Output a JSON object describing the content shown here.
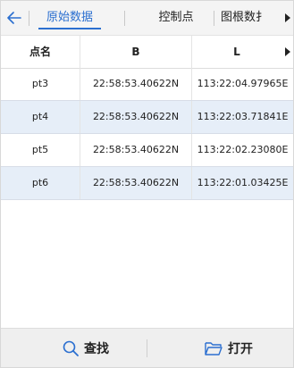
{
  "tabs": [
    {
      "label": "原始数据",
      "active": true
    },
    {
      "label": "控制点",
      "active": false
    },
    {
      "label": "图根数扌",
      "active": false
    }
  ],
  "table": {
    "columns": [
      "点名",
      "B",
      "L"
    ],
    "rows": [
      {
        "name": "pt3",
        "b": "22:58:53.40622N",
        "l": "113:22:04.97965E",
        "selected": false
      },
      {
        "name": "pt4",
        "b": "22:58:53.40622N",
        "l": "113:22:03.71841E",
        "selected": true
      },
      {
        "name": "pt5",
        "b": "22:58:53.40622N",
        "l": "113:22:02.23080E",
        "selected": false
      },
      {
        "name": "pt6",
        "b": "22:58:53.40622N",
        "l": "113:22:01.03425E",
        "selected": true
      }
    ]
  },
  "bottom": {
    "find_label": "查找",
    "open_label": "打开"
  },
  "colors": {
    "accent": "#2b6fd0",
    "selected_row": "#e6eef8",
    "bar_bg": "#f4f4f4"
  },
  "icons": {
    "back": "arrow-left-icon",
    "find": "magnifier-icon",
    "open": "folder-open-icon",
    "more": "triangle-right-icon"
  }
}
